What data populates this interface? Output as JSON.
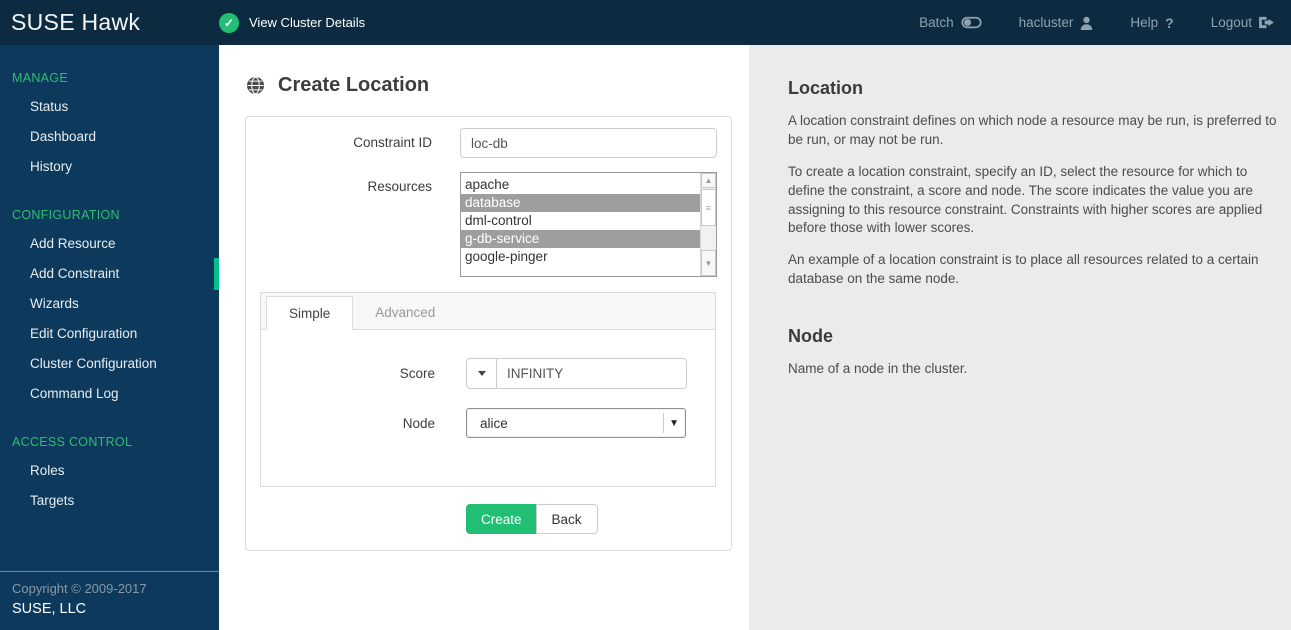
{
  "header": {
    "brand": "SUSE Hawk",
    "cluster_status_label": "View Cluster Details",
    "nav": [
      {
        "label": "Batch",
        "icon": "toggle-icon"
      },
      {
        "label": "hacluster",
        "icon": "user-icon"
      },
      {
        "label": "Help",
        "icon": "help-icon"
      },
      {
        "label": "Logout",
        "icon": "logout-icon"
      }
    ]
  },
  "sidebar": {
    "sections": [
      {
        "title": "MANAGE",
        "items": [
          {
            "label": "Status"
          },
          {
            "label": "Dashboard"
          },
          {
            "label": "History"
          }
        ]
      },
      {
        "title": "CONFIGURATION",
        "items": [
          {
            "label": "Add Resource"
          },
          {
            "label": "Add Constraint",
            "active": true
          },
          {
            "label": "Wizards"
          },
          {
            "label": "Edit Configuration"
          },
          {
            "label": "Cluster Configuration"
          },
          {
            "label": "Command Log"
          }
        ]
      },
      {
        "title": "ACCESS CONTROL",
        "items": [
          {
            "label": "Roles"
          },
          {
            "label": "Targets"
          }
        ]
      }
    ],
    "footer": {
      "copyright": "Copyright © 2009-2017",
      "company": "SUSE, LLC"
    }
  },
  "main": {
    "title": "Create Location",
    "form": {
      "constraint_id": {
        "label": "Constraint ID",
        "value": "loc-db"
      },
      "resources": {
        "label": "Resources",
        "options": [
          {
            "label": "apache",
            "selected": false
          },
          {
            "label": "database",
            "selected": true
          },
          {
            "label": "dml-control",
            "selected": false
          },
          {
            "label": "g-db-service",
            "selected": true
          },
          {
            "label": "google-pinger",
            "selected": false
          }
        ]
      },
      "tabs": [
        {
          "label": "Simple",
          "active": true
        },
        {
          "label": "Advanced",
          "active": false
        }
      ],
      "score": {
        "label": "Score",
        "value": "INFINITY"
      },
      "node": {
        "label": "Node",
        "value": "alice"
      },
      "buttons": {
        "create": "Create",
        "back": "Back"
      }
    }
  },
  "help": {
    "location": {
      "title": "Location",
      "paragraphs": [
        "A location constraint defines on which node a resource may be run, is preferred to be run, or may not be run.",
        "To create a location constraint, specify an ID, select the resource for which to define the constraint, a score and node. The score indicates the value you are assigning to this resource constraint. Constraints with higher scores are applied before those with lower scores.",
        "An example of a location constraint is to place all resources related to a certain database on the same node."
      ]
    },
    "node": {
      "title": "Node",
      "text": "Name of a node in the cluster."
    }
  },
  "colors": {
    "header_bg": "#0d2b40",
    "sidebar_bg": "#0d3a5c",
    "accent_green": "#21bf73",
    "indicator_green": "#00c08b",
    "section_title_green": "#2ebd70",
    "help_panel_bg": "#ebebeb",
    "selected_option_bg": "#9e9e9e"
  }
}
